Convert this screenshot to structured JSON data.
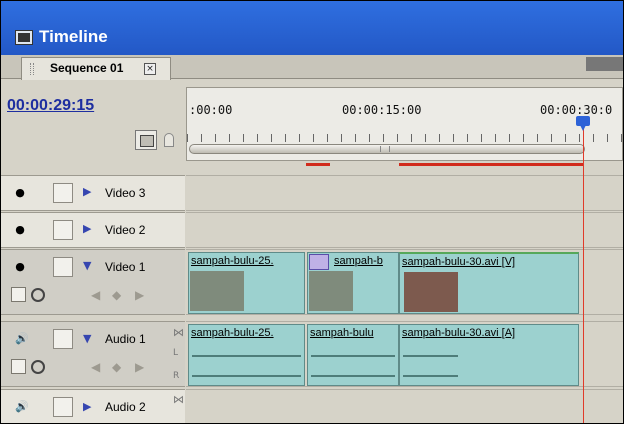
{
  "window": {
    "title": "Timeline"
  },
  "tab": {
    "label": "Sequence 01",
    "close": "×"
  },
  "timecode": "00:00:29:15",
  "ruler": {
    "labels": [
      ":00:00",
      "00:00:15:00",
      "00:00:30:0"
    ]
  },
  "tracks": {
    "video": [
      {
        "name": "Video 3"
      },
      {
        "name": "Video 2"
      },
      {
        "name": "Video 1"
      }
    ],
    "audio": [
      {
        "name": "Audio 1"
      },
      {
        "name": "Audio 2"
      }
    ]
  },
  "clips": {
    "video1": [
      {
        "name": "sampah-bulu-25."
      },
      {
        "name": "sampah-b"
      },
      {
        "name": "sampah-bulu-30.avi [V]"
      }
    ],
    "audio1": [
      {
        "name": "sampah-bulu-25."
      },
      {
        "name": "sampah-bulu"
      },
      {
        "name": "sampah-bulu-30.avi [A]"
      }
    ]
  },
  "letters": {
    "l": "L",
    "r": "R"
  }
}
